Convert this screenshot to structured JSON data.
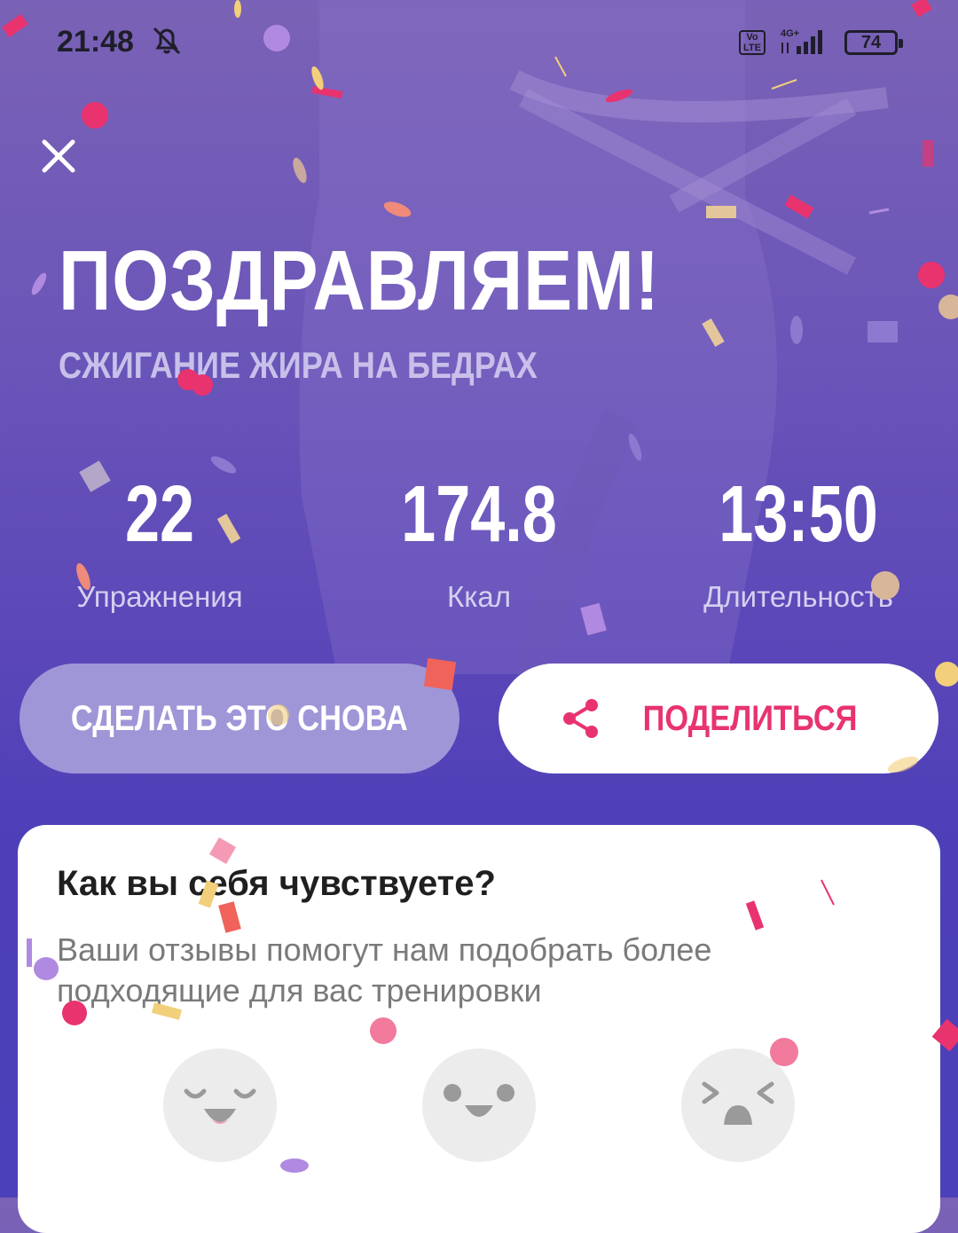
{
  "status_bar": {
    "time": "21:48",
    "icons": [
      "bell-off-icon",
      "volte-icon",
      "signal-4g-icon"
    ],
    "volte_label": "Vo LTE",
    "network_label": "4G+",
    "battery": "74"
  },
  "header": {
    "close_icon": "close-icon",
    "title": "ПОЗДРАВЛЯЕМ!",
    "subtitle": "СЖИГАНИЕ ЖИРА НА БЕДРАХ"
  },
  "stats": [
    {
      "value": "22",
      "label": "Упражнения"
    },
    {
      "value": "174.8",
      "label": "Ккал"
    },
    {
      "value": "13:50",
      "label": "Длительность"
    }
  ],
  "actions": {
    "repeat_label": "СДЕЛАТЬ ЭТО СНОВА",
    "share_label": "ПОДЕЛИТЬСЯ",
    "share_icon": "share-icon"
  },
  "feedback": {
    "title": "Как вы себя чувствуете?",
    "description": "Ваши отзывы помогут нам подобрать более подходящие для вас тренировки",
    "faces": [
      "happy-face-icon",
      "neutral-face-icon",
      "tired-face-icon"
    ]
  },
  "colors": {
    "accent": "#e8336f",
    "primary_bg": "#4d3fb8",
    "secondary_button": "#9f96d8"
  }
}
